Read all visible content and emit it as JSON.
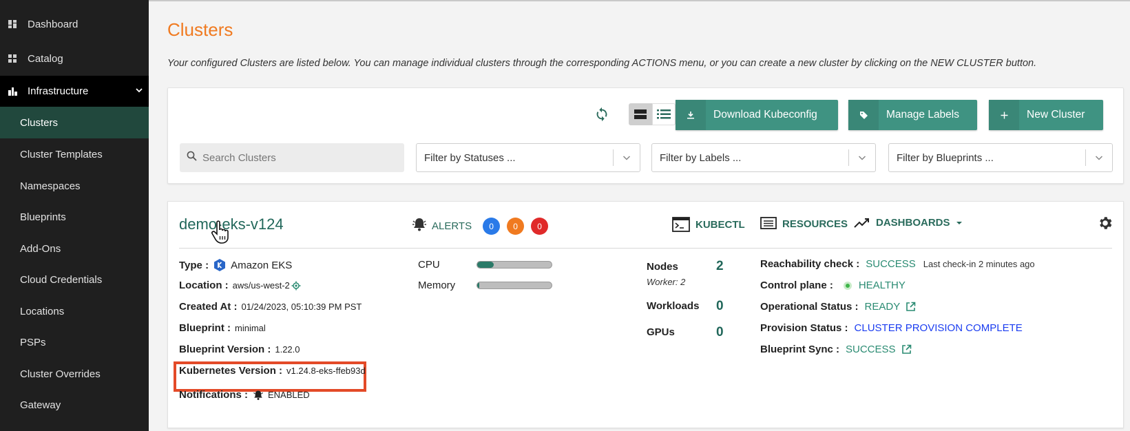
{
  "sidebar": {
    "items": [
      {
        "label": "Dashboard",
        "icon": "dashboard-icon"
      },
      {
        "label": "Catalog",
        "icon": "catalog-icon"
      },
      {
        "label": "Infrastructure",
        "icon": "infrastructure-icon",
        "expanded": true
      },
      {
        "label": "Clusters",
        "active": true
      },
      {
        "label": "Cluster Templates"
      },
      {
        "label": "Namespaces"
      },
      {
        "label": "Blueprints"
      },
      {
        "label": "Add-Ons"
      },
      {
        "label": "Cloud Credentials"
      },
      {
        "label": "Locations"
      },
      {
        "label": "PSPs"
      },
      {
        "label": "Cluster Overrides"
      },
      {
        "label": "Gateway"
      }
    ]
  },
  "page": {
    "title": "Clusters",
    "description": "Your configured Clusters are listed below. You can manage individual clusters through the corresponding ACTIONS menu, or you can create a new cluster by clicking on the NEW CLUSTER button."
  },
  "toolbar": {
    "download_label": "Download Kubeconfig",
    "labels_label": "Manage Labels",
    "new_label": "New Cluster",
    "search_placeholder": "Search Clusters",
    "filter_statuses": "Filter by Statuses ...",
    "filter_labels": "Filter by Labels ...",
    "filter_blueprints": "Filter by Blueprints ..."
  },
  "cluster": {
    "name": "demo-eks-v124",
    "alerts_label": "ALERTS",
    "alerts": [
      {
        "count": "0",
        "color": "#2a7ae8"
      },
      {
        "count": "0",
        "color": "#f07a20"
      },
      {
        "count": "0",
        "color": "#e02a2a"
      }
    ],
    "kubectl_label": "KUBECTL",
    "resources_label": "RESOURCES",
    "dashboards_label": "DASHBOARDS",
    "type_label": "Type :",
    "type_value": "Amazon EKS",
    "location_label": "Location :",
    "location_value": "aws/us-west-2",
    "created_label": "Created At :",
    "created_value": "01/24/2023, 05:10:39 PM PST",
    "blueprint_label": "Blueprint :",
    "blueprint_value": "minimal",
    "blueprint_version_label": "Blueprint Version :",
    "blueprint_version_value": "1.22.0",
    "k8s_version_label": "Kubernetes Version :",
    "k8s_version_value": "v1.24.8-eks-ffeb93d",
    "notifications_label": "Notifications :",
    "notifications_value": "ENABLED",
    "cpu_label": "CPU",
    "cpu_usage": 0.22,
    "memory_label": "Memory",
    "memory_usage": 0.03,
    "nodes_label": "Nodes",
    "nodes_value": "2",
    "worker_label": "Worker: 2",
    "workloads_label": "Workloads",
    "workloads_value": "0",
    "gpus_label": "GPUs",
    "gpus_value": "0",
    "reachability_label": "Reachability check :",
    "reachability_value": "SUCCESS",
    "last_checkin": "Last check-in  2 minutes ago",
    "control_plane_label": "Control plane :",
    "control_plane_value": "HEALTHY",
    "operational_label": "Operational Status :",
    "operational_value": "READY",
    "provision_label": "Provision Status :",
    "provision_value": "CLUSTER PROVISION COMPLETE",
    "sync_label": "Blueprint Sync :",
    "sync_value": "SUCCESS"
  }
}
